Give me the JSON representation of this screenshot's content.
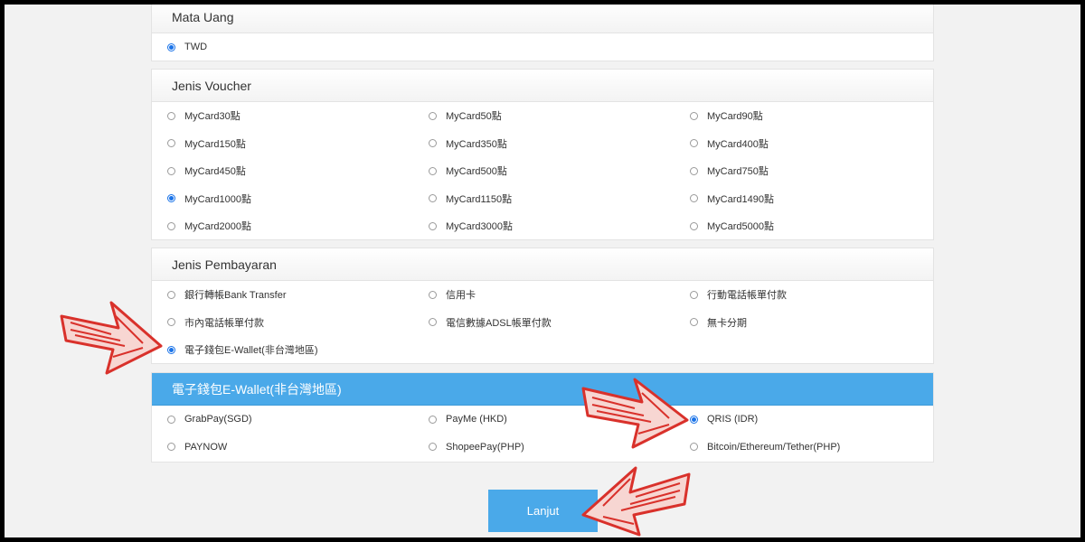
{
  "currency": {
    "title": "Mata Uang",
    "options": [
      {
        "label": "TWD",
        "selected": true
      }
    ]
  },
  "voucher": {
    "title": "Jenis Voucher",
    "options": [
      {
        "label": "MyCard30點",
        "selected": false
      },
      {
        "label": "MyCard50點",
        "selected": false
      },
      {
        "label": "MyCard90點",
        "selected": false
      },
      {
        "label": "MyCard150點",
        "selected": false
      },
      {
        "label": "MyCard350點",
        "selected": false
      },
      {
        "label": "MyCard400點",
        "selected": false
      },
      {
        "label": "MyCard450點",
        "selected": false
      },
      {
        "label": "MyCard500點",
        "selected": false
      },
      {
        "label": "MyCard750點",
        "selected": false
      },
      {
        "label": "MyCard1000點",
        "selected": true
      },
      {
        "label": "MyCard1150點",
        "selected": false
      },
      {
        "label": "MyCard1490點",
        "selected": false
      },
      {
        "label": "MyCard2000點",
        "selected": false
      },
      {
        "label": "MyCard3000點",
        "selected": false
      },
      {
        "label": "MyCard5000點",
        "selected": false
      }
    ]
  },
  "payment": {
    "title": "Jenis Pembayaran",
    "options": [
      {
        "label": "銀行轉帳Bank Transfer",
        "selected": false
      },
      {
        "label": "信用卡",
        "selected": false
      },
      {
        "label": "行動電話帳單付款",
        "selected": false
      },
      {
        "label": "市內電話帳單付款",
        "selected": false
      },
      {
        "label": "電信數據ADSL帳單付款",
        "selected": false
      },
      {
        "label": "無卡分期",
        "selected": false
      },
      {
        "label": "電子錢包E-Wallet(非台灣地區)",
        "selected": true
      }
    ]
  },
  "ewallet": {
    "title": "電子錢包E-Wallet(非台灣地區)",
    "options": [
      {
        "label": "GrabPay(SGD)",
        "selected": false
      },
      {
        "label": "PayMe (HKD)",
        "selected": false
      },
      {
        "label": "QRIS (IDR)",
        "selected": true
      },
      {
        "label": "PAYNOW",
        "selected": false
      },
      {
        "label": "ShopeePay(PHP)",
        "selected": false
      },
      {
        "label": "Bitcoin/Ethereum/Tether(PHP)",
        "selected": false
      }
    ]
  },
  "submit": {
    "label": "Lanjut"
  },
  "colors": {
    "accent": "#4aa9e9",
    "radio": "#1a73e8",
    "arrow": "#d9312b"
  }
}
